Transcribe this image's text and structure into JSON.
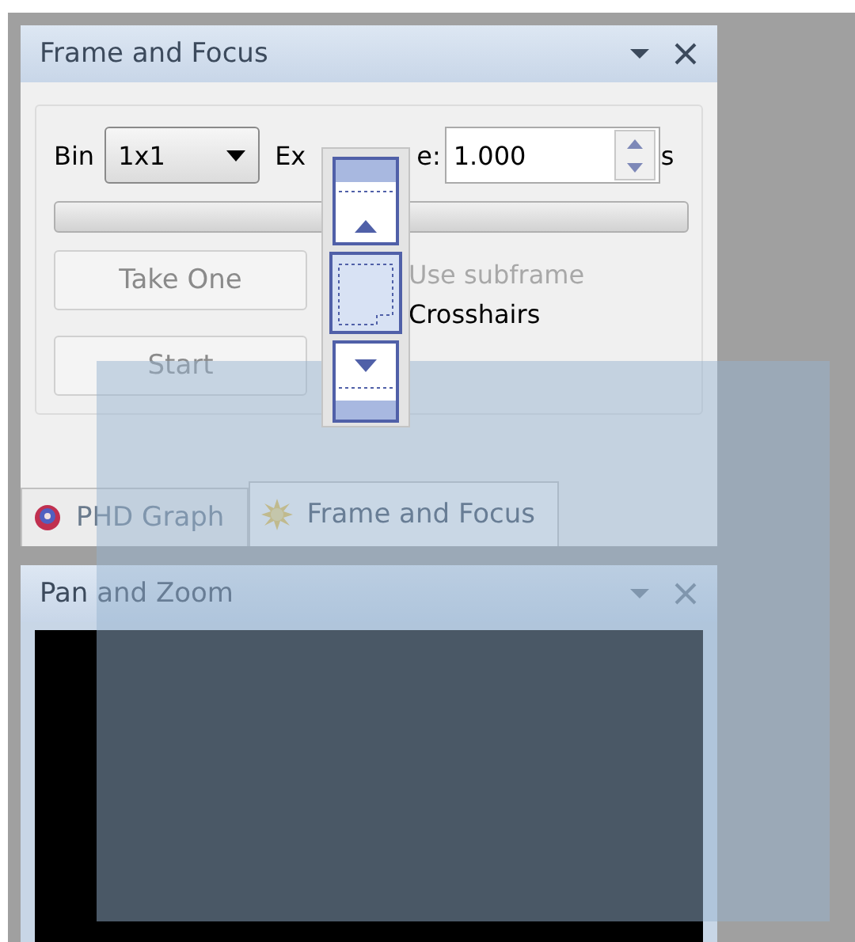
{
  "frame_panel": {
    "title": "Frame and Focus",
    "bin": {
      "label": "Bin",
      "value": "1x1"
    },
    "exposure": {
      "label_start": "Ex",
      "label_end": "e:",
      "value": "1.000",
      "unit": "s"
    },
    "progress": {
      "level": 0
    },
    "buttons": [
      {
        "label": "Take One",
        "disabled": true
      },
      {
        "label": "Start",
        "disabled": true
      }
    ],
    "options": [
      {
        "label": "Use subframe",
        "disabled": true
      },
      {
        "label": "Crosshairs",
        "disabled": false
      }
    ]
  },
  "tabs": [
    {
      "label": "PHD Graph",
      "selected": false
    },
    {
      "label": "Frame and Focus",
      "selected": true
    }
  ],
  "pan_panel": {
    "title": "Pan and Zoom"
  }
}
